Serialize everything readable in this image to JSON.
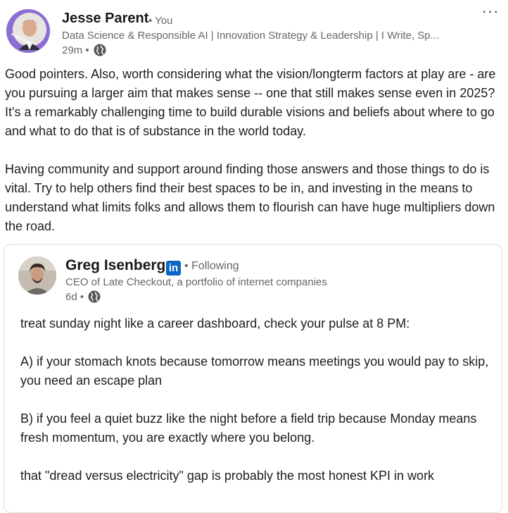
{
  "comment": {
    "author": {
      "name": "Jesse Parent",
      "relation": "• You",
      "headline": "Data Science & Responsible AI | Innovation Strategy & Leadership | I Write, Sp...",
      "time": "29m •",
      "avatar_badge": "#HIRING",
      "avatar_icon": "avatar-hiring-frame"
    },
    "more_icon": "ellipsis-icon",
    "more_label": "···",
    "paragraphs": [
      "Good pointers. Also, worth considering what the vision/longterm factors at play are - are you pursuing a larger aim that makes sense -- one that still makes sense even in 2025? It's a remarkably challenging time to build durable visions and beliefs about where to go and what to do that is of substance in the world today.",
      "Having community and support around finding those answers and those things to do is vital. Try to help others find their best spaces to be in, and investing in the means to understand what limits folks and allows them to flourish can have huge multipliers down the road."
    ]
  },
  "shared_post": {
    "author": {
      "name": "Greg Isenberg",
      "badge_label": "in",
      "relation": "• Following",
      "headline": "CEO of Late Checkout, a portfolio of internet companies",
      "time": "6d •"
    },
    "paragraphs": [
      "treat sunday night like a career dashboard, check your pulse at 8 PM:",
      "A) if your stomach knots because tomorrow means meetings you would pay to skip, you need an escape plan",
      "B) if you feel a quiet buzz like the night before a field trip because Monday means fresh momentum, you are exactly where you belong.",
      "that \"dread versus electricity\" gap is probably the most honest KPI in work"
    ]
  },
  "colors": {
    "hiring_frame": "#8c6dd3",
    "linkedin_blue": "#0a66c2",
    "secondary_text": "#666666"
  }
}
